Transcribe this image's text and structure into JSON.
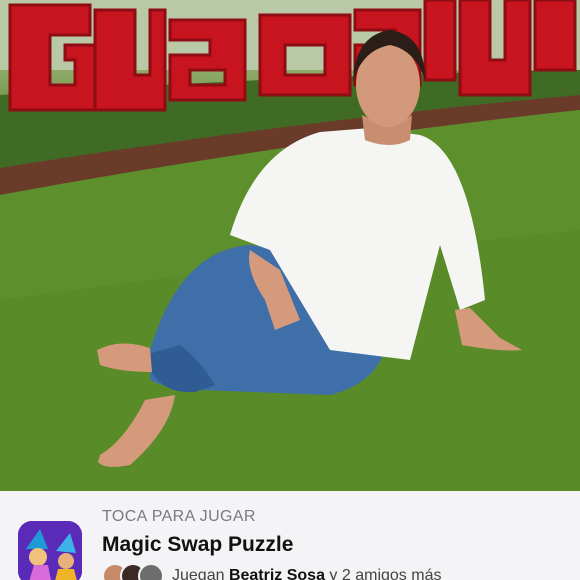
{
  "card": {
    "eyebrow": "TOCA PARA JUGAR",
    "app_name": "Magic Swap Puzzle",
    "social_prefix": "Juegan ",
    "social_name": "Beatriz Sosa",
    "social_suffix": " y 2 amigos más",
    "background_color": "#f4f4f6"
  },
  "photo": {
    "sign_text": "Guadalupe",
    "sign_color": "#c8141e"
  },
  "icons": {
    "app_icon": "magic-swap-puzzle-app-icon",
    "avatars": [
      "friend-avatar",
      "friend-avatar",
      "friend-avatar"
    ]
  }
}
